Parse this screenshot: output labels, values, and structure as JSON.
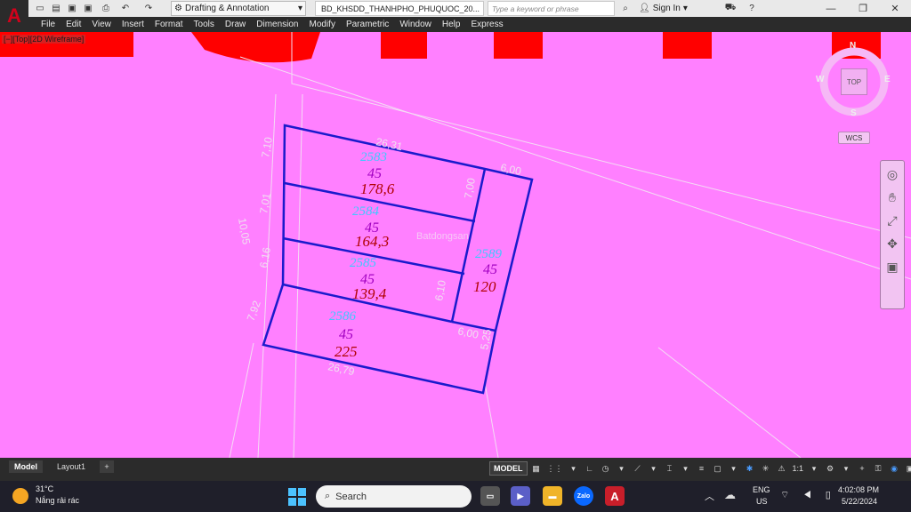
{
  "title_bar": {
    "workspace": "Drafting & Annotation",
    "document_title": "BD_KHSDD_THANHPHO_PHUQUOC_20...",
    "search_placeholder": "Type a keyword or phrase",
    "sign_in": "Sign In"
  },
  "menu": [
    "File",
    "Edit",
    "View",
    "Insert",
    "Format",
    "Tools",
    "Draw",
    "Dimension",
    "Modify",
    "Parametric",
    "Window",
    "Help",
    "Express"
  ],
  "viewport_label": "[−][Top][2D Wireframe]",
  "drawing": {
    "background_color": "#ff80ff",
    "parcel_outline_color": "#1a1acc",
    "parcels": [
      {
        "id": "2583",
        "land_code": "45",
        "area": "178,6"
      },
      {
        "id": "2584",
        "land_code": "45",
        "area": "164,3"
      },
      {
        "id": "2585",
        "land_code": "45",
        "area": "139,4"
      },
      {
        "id": "2586",
        "land_code": "45",
        "area": "225"
      },
      {
        "id": "2589",
        "land_code": "45",
        "area": "120"
      }
    ],
    "dimensions": [
      "26,31",
      "6,00",
      "7,10",
      "7,00",
      "7,01",
      "6,16",
      "6,10",
      "6,00",
      "10,05",
      "7,92",
      "26,79",
      "5,25"
    ],
    "watermark": "Batdongsan"
  },
  "viewcube": {
    "north": "N",
    "south": "S",
    "east": "E",
    "west": "W",
    "face": "TOP",
    "wcs": "WCS"
  },
  "layout_tabs": {
    "model": "Model",
    "layout1": "Layout1",
    "add": "+"
  },
  "status_bar": {
    "model": "MODEL",
    "scale": "1:1"
  },
  "taskbar": {
    "weather_temp": "31°C",
    "weather_desc": "Nắng rải rác",
    "search": "Search",
    "app_zalo": "Zalo",
    "app_autocad": "A",
    "lang_top": "ENG",
    "lang_bottom": "US",
    "time": "4:02:08 PM",
    "date": "5/22/2024"
  }
}
